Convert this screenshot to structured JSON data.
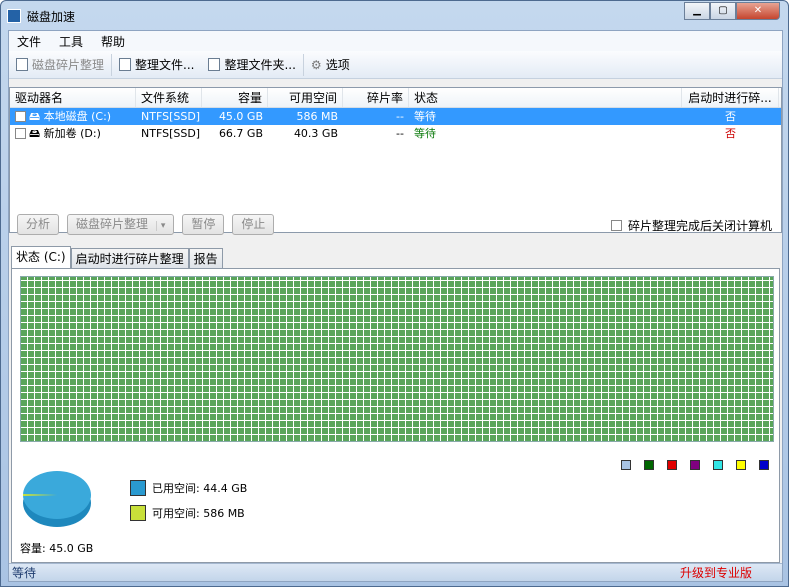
{
  "window": {
    "title": "磁盘加速"
  },
  "menu": [
    "文件",
    "工具",
    "帮助"
  ],
  "toolbar": {
    "defrag": "磁盘碎片整理",
    "defrag_file": "整理文件...",
    "defrag_folder": "整理文件夹...",
    "options": "选项"
  },
  "columns": [
    "驱动器名",
    "文件系统",
    "容量",
    "可用空间",
    "碎片率",
    "状态",
    "启动时进行碎..."
  ],
  "drives": [
    {
      "name": "本地磁盘 (C:)",
      "fs": "NTFS[SSD]",
      "capacity": "45.0 GB",
      "free": "586 MB",
      "frag": "--",
      "status": "等待",
      "boot": "否"
    },
    {
      "name": "新加卷 (D:)",
      "fs": "NTFS[SSD]",
      "capacity": "66.7 GB",
      "free": "40.3 GB",
      "frag": "--",
      "status": "等待",
      "boot": "否"
    }
  ],
  "actions": {
    "analyze": "分析",
    "defrag": "磁盘碎片整理",
    "pause": "暂停",
    "stop": "停止",
    "shutdown": "碎片整理完成后关闭计算机"
  },
  "tabs": [
    "状态 (C:)",
    "启动时进行碎片整理",
    "报告"
  ],
  "legend_colors": [
    "#a9c4e4",
    "#006600",
    "#e00000",
    "#800080",
    "#33e6e6",
    "#ffff00",
    "#0000cc"
  ],
  "usage": {
    "used_label": "已用空间: 44.4 GB",
    "free_label": "可用空间: 586 MB",
    "capacity_label": "容量: 45.0 GB",
    "used_fraction": 0.987,
    "used_color": "#2a9ad0",
    "free_color": "#c8e03a"
  },
  "statusbar": {
    "text": "等待",
    "upgrade": "升级到专业版"
  }
}
